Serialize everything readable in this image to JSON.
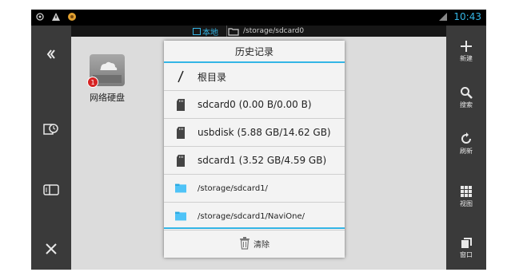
{
  "status_bar": {
    "time": "10:43",
    "left_icons": [
      "location-icon",
      "warning-icon",
      "app-icon"
    ],
    "right_icons": [
      "signal-icon"
    ]
  },
  "tabs": {
    "local_label": "本地",
    "path": "/storage/sdcard0"
  },
  "left_bar": {
    "items": [
      "back-icon",
      "history-icon",
      "storage-icon",
      "close-icon"
    ]
  },
  "right_bar": {
    "items": [
      {
        "icon": "plus-icon",
        "label": "新建"
      },
      {
        "icon": "search-icon",
        "label": "搜索"
      },
      {
        "icon": "refresh-icon",
        "label": "刷新"
      },
      {
        "icon": "grid-view-icon",
        "label": "视图"
      },
      {
        "icon": "window-icon",
        "label": "窗口"
      }
    ]
  },
  "drive": {
    "label": "网络硬盘",
    "badge": "1"
  },
  "history_dialog": {
    "title": "历史记录",
    "items": [
      {
        "icon": "root-slash-icon",
        "label": "根目录"
      },
      {
        "icon": "sd-card-icon",
        "label": "sdcard0 (0.00 B/0.00 B)"
      },
      {
        "icon": "sd-card-icon",
        "label": "usbdisk (5.88 GB/14.62 GB)"
      },
      {
        "icon": "sd-card-icon",
        "label": "sdcard1 (3.52 GB/4.59 GB)"
      },
      {
        "icon": "folder-icon",
        "label": "/storage/sdcard1/"
      },
      {
        "icon": "folder-icon",
        "label": "/storage/sdcard1/NaviOne/"
      }
    ],
    "clear_label": "清除"
  },
  "colors": {
    "accent": "#33b5e5",
    "bar_bg": "#3a3a3a",
    "main_bg": "#dcdcdc",
    "folder": "#4fc3f7"
  }
}
